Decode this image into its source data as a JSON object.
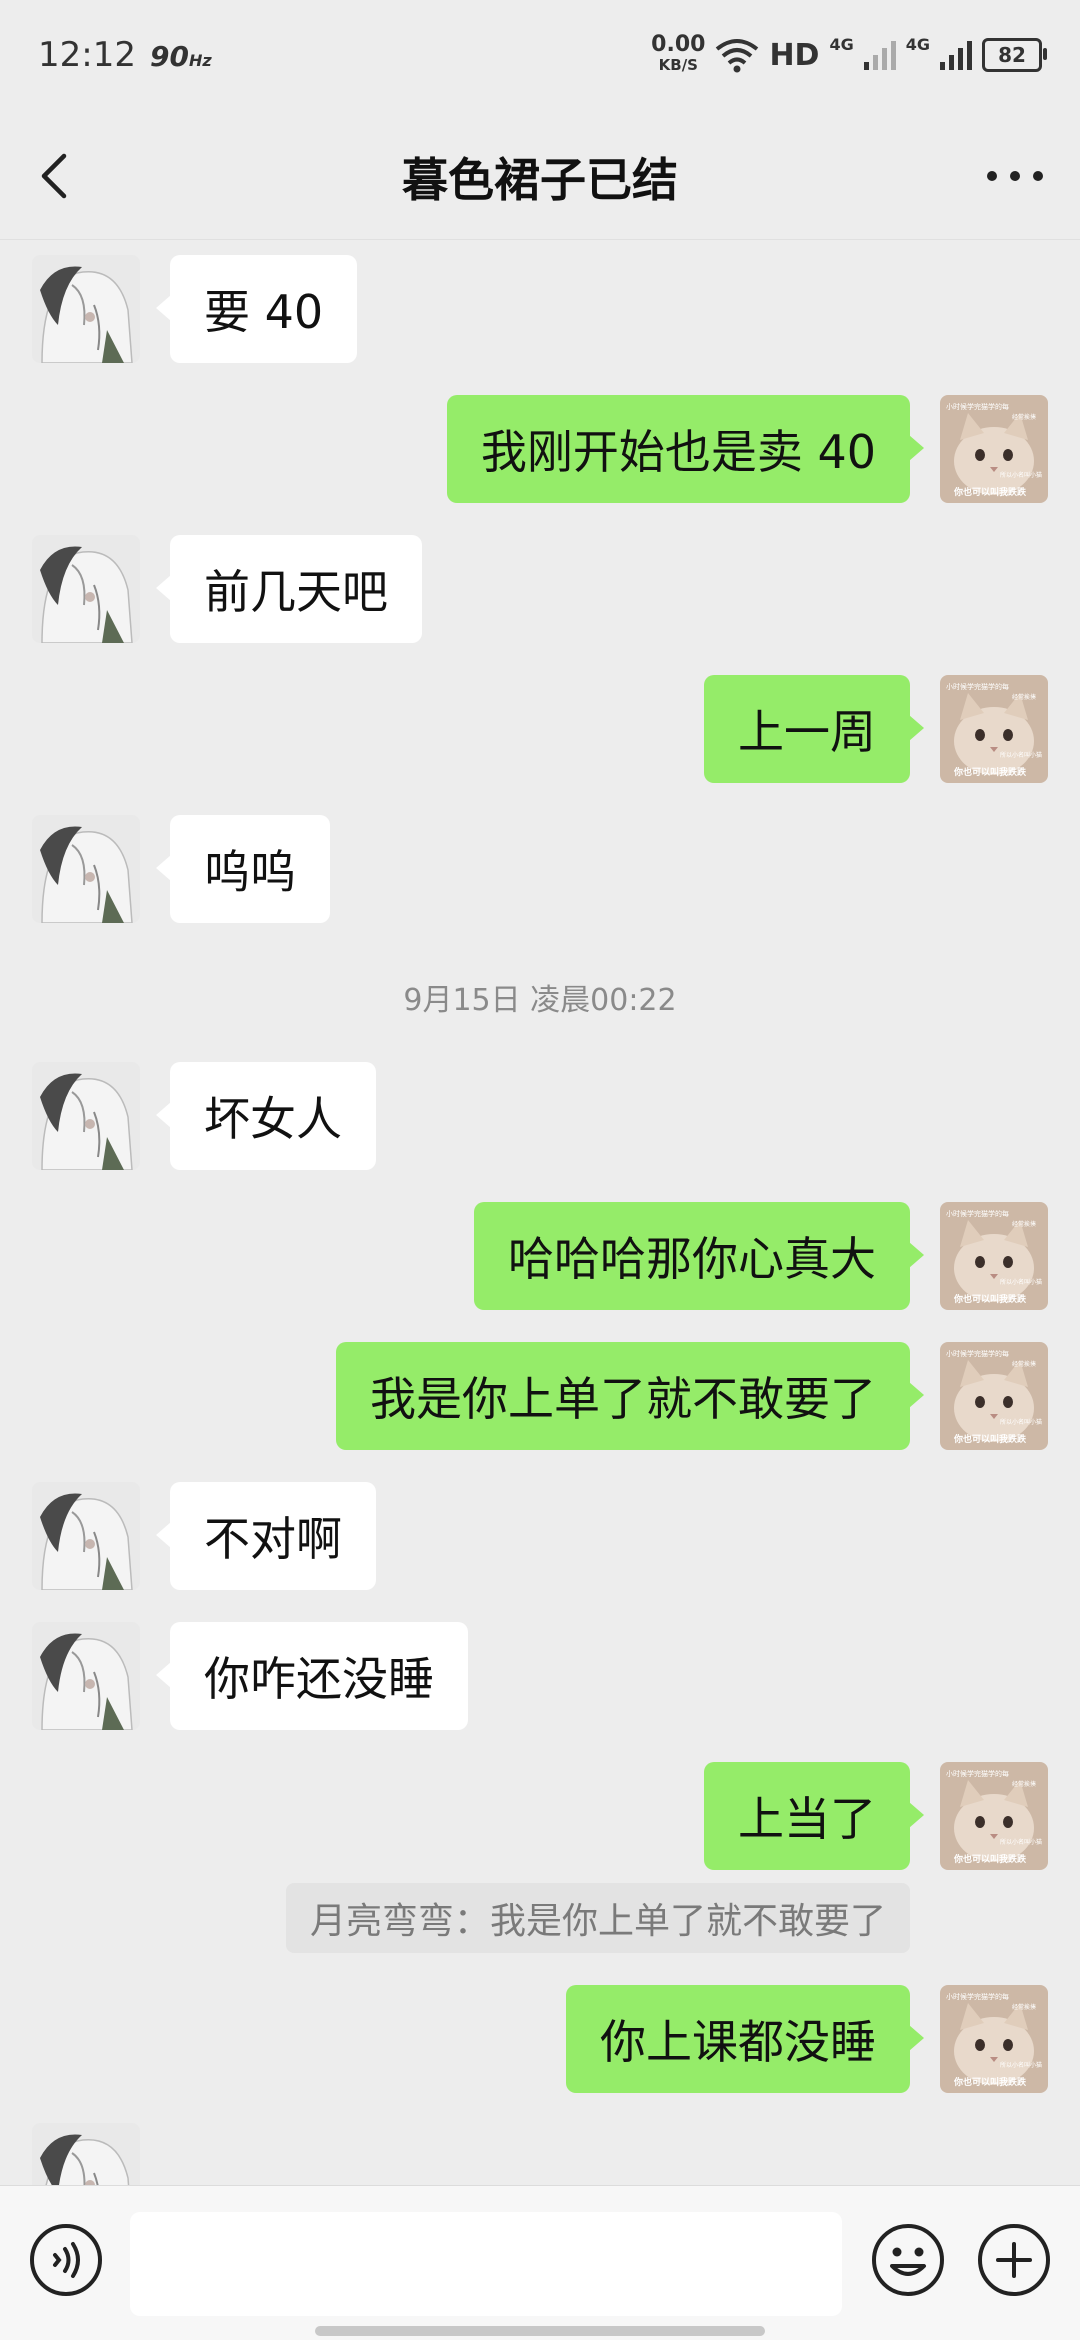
{
  "status_bar": {
    "time": "12:12",
    "refresh": "90",
    "refresh_unit": "Hz",
    "net_speed": "0.00",
    "net_unit": "KB/S",
    "hd": "HD",
    "signal_1": "4G",
    "signal_2": "4G",
    "battery": "82"
  },
  "header": {
    "title": "暮色裙子已结"
  },
  "messages": [
    {
      "side": "left",
      "text": "要 40"
    },
    {
      "side": "right",
      "text": "我刚开始也是卖 40"
    },
    {
      "side": "left",
      "text": "前几天吧"
    },
    {
      "side": "right",
      "text": "上一周"
    },
    {
      "side": "left",
      "text": "呜呜"
    },
    {
      "side": "left",
      "text": "坏女人"
    },
    {
      "side": "right",
      "text": "哈哈哈那你心真大"
    },
    {
      "side": "right",
      "text": "我是你上单了就不敢要了"
    },
    {
      "side": "left",
      "text": "不对啊"
    },
    {
      "side": "left",
      "text": "你咋还没睡"
    },
    {
      "side": "right",
      "text": "上当了"
    },
    {
      "side": "right",
      "text": "你上课都没睡"
    }
  ],
  "timestamp": "9月15日 凌晨00:22",
  "quote": "月亮弯弯：我是你上单了就不敢要了",
  "avatars": {
    "self_caption_1": "小时候学完猫学的每",
    "self_caption_2": "经常挨揍",
    "self_caption_3": "所以小名叫小猫",
    "self_caption_4": "你也可以叫我跌跌"
  },
  "colors": {
    "background": "#ededed",
    "bubble_self": "#95ec69",
    "bubble_other": "#ffffff"
  },
  "input": {
    "placeholder": "",
    "value": ""
  }
}
